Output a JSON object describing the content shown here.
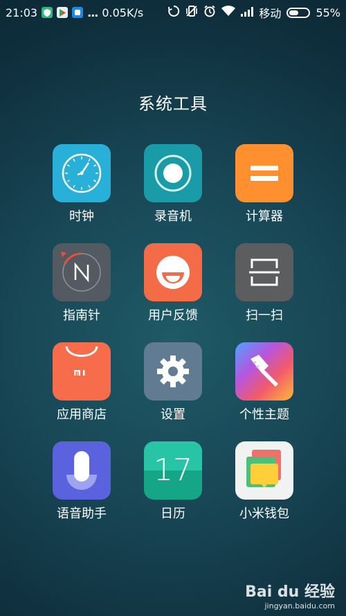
{
  "status_bar": {
    "time": "21:03",
    "more_notifications": "...",
    "net_speed": "0.05K/s",
    "carrier": "移动",
    "battery_level": "55%",
    "battery_fraction": 0.55
  },
  "folder": {
    "title": "系统工具"
  },
  "apps": [
    {
      "label": "时钟",
      "icon": "clock-icon",
      "color": "#29b0d8"
    },
    {
      "label": "录音机",
      "icon": "recorder-icon",
      "color": "#1a9ba8"
    },
    {
      "label": "计算器",
      "icon": "calculator-icon",
      "color": "#ff8f2f"
    },
    {
      "label": "指南针",
      "icon": "compass-icon",
      "color": "#545a62"
    },
    {
      "label": "用户反馈",
      "icon": "feedback-icon",
      "color": "#f46b48"
    },
    {
      "label": "扫一扫",
      "icon": "scanner-icon",
      "color": "#5b5d5f"
    },
    {
      "label": "应用商店",
      "icon": "app-store-icon",
      "color": "#f76d4c"
    },
    {
      "label": "设置",
      "icon": "settings-gear-icon",
      "color": "#607b92"
    },
    {
      "label": "个性主题",
      "icon": "theme-brush-icon",
      "color": "#c14fd7"
    },
    {
      "label": "语音助手",
      "icon": "voice-assistant-icon",
      "color": "#5a62de"
    },
    {
      "label": "日历",
      "icon": "calendar-icon",
      "color": "#1caf8f",
      "day": "17"
    },
    {
      "label": "小米钱包",
      "icon": "wallet-icon",
      "color": "#f1f2f2"
    }
  ],
  "watermark": {
    "logo": "Bai du 经验",
    "url": "jingyan.baidu.com"
  }
}
